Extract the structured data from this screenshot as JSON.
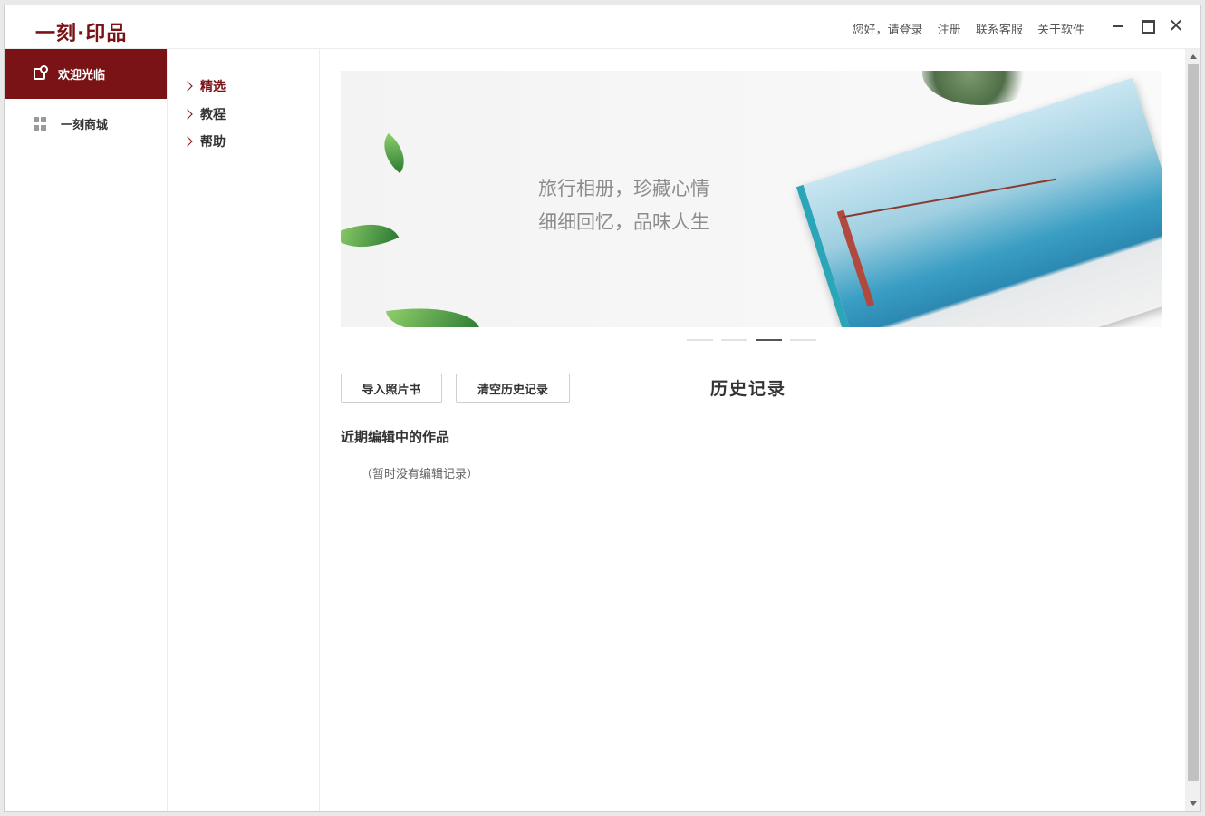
{
  "app": {
    "logo_text": "一刻·印品",
    "brand_color": "#7a1316"
  },
  "header": {
    "links": [
      "您好，请登录",
      "注册",
      "联系客服",
      "关于软件"
    ]
  },
  "window_controls": {
    "close_glyph": "✕"
  },
  "nav_primary": {
    "items": [
      {
        "label": "欢迎光临",
        "icon": "home-icon",
        "active": true
      },
      {
        "label": "一刻商城",
        "icon": "grid-icon",
        "active": false
      }
    ]
  },
  "nav_secondary": {
    "items": [
      {
        "label": "精选",
        "active": true
      },
      {
        "label": "教程",
        "active": false
      },
      {
        "label": "帮助",
        "active": false
      }
    ]
  },
  "banner": {
    "line1": "旅行相册，珍藏心情",
    "line2": "细细回忆，品味人生",
    "slide_count": 4,
    "active_slide": 3
  },
  "actions": {
    "import_label": "导入照片书",
    "clear_label": "清空历史记录"
  },
  "history": {
    "title": "历史记录",
    "recent_title": "近期编辑中的作品",
    "empty_note": "（暂时没有编辑记录）"
  }
}
